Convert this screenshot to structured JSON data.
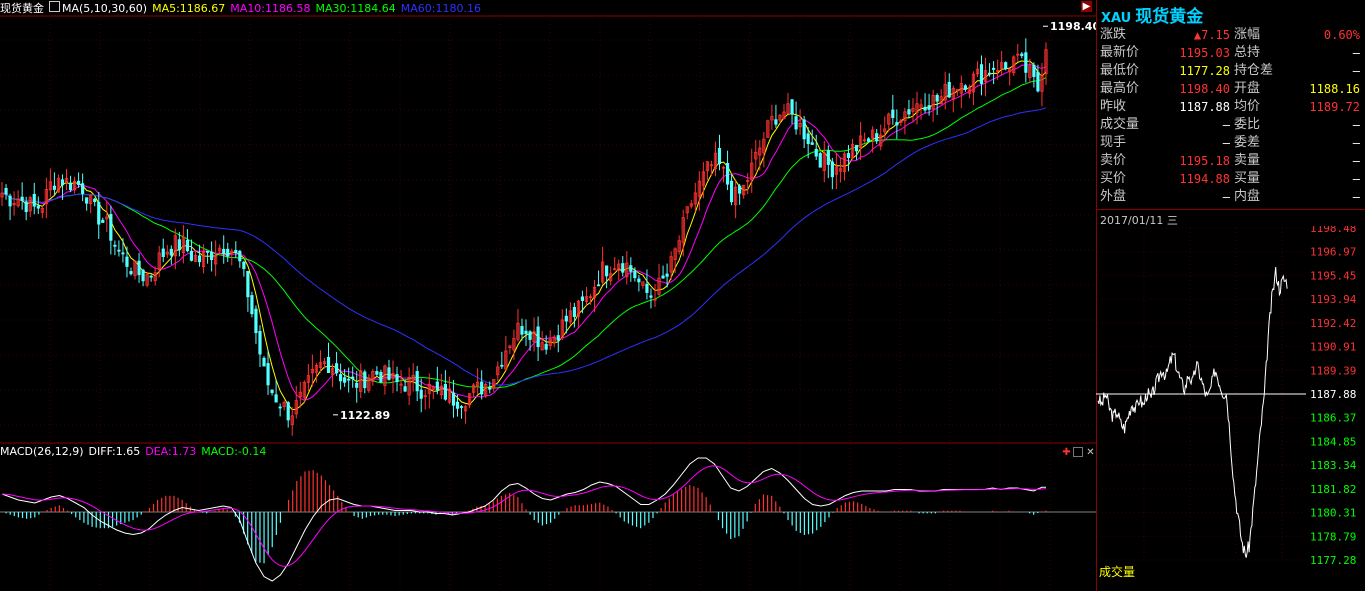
{
  "window": {
    "symbol_name": "现货黄金",
    "ma_indicator": "MA(5,10,30,60)",
    "ma5": "MA5:1186.67",
    "ma10": "MA10:1186.58",
    "ma30": "MA30:1184.64",
    "ma60": "MA60:1180.16",
    "macd_indicator": "MACD(26,12,9)",
    "diff": "DIFF:1.65",
    "dea": "DEA:1.73",
    "macd": "MACD:-0.14",
    "colors": {
      "ma5": "#ffff00",
      "ma10": "#ff00ff",
      "ma30": "#00ff00",
      "ma60": "#3030ff",
      "up": "#ff3232",
      "down": "#54ffff",
      "accent": "#00d2ff"
    }
  },
  "quote_panel": {
    "code": "XAU",
    "name": "现货黄金",
    "rows": [
      {
        "l1": "涨跌",
        "v1": "▲7.15",
        "c1": "red",
        "l2": "涨幅",
        "v2": "0.60%",
        "c2": "red"
      },
      {
        "l1": "最新价",
        "v1": "1195.03",
        "c1": "red",
        "l2": "总持",
        "v2": "—",
        "c2": "wht"
      },
      {
        "l1": "最低价",
        "v1": "1177.28",
        "c1": "yel",
        "l2": "持仓差",
        "v2": "—",
        "c2": "wht"
      },
      {
        "l1": "最高价",
        "v1": "1198.40",
        "c1": "red",
        "l2": "开盘",
        "v2": "1188.16",
        "c2": "yel"
      },
      {
        "l1": "昨收",
        "v1": "1187.88",
        "c1": "wht",
        "l2": "均价",
        "v2": "1189.72",
        "c2": "red"
      },
      {
        "l1": "成交量",
        "v1": "—",
        "c1": "wht",
        "l2": "委比",
        "v2": "—",
        "c2": "wht"
      },
      {
        "l1": "现手",
        "v1": "—",
        "c1": "wht",
        "l2": "委差",
        "v2": "—",
        "c2": "wht"
      },
      {
        "l1": "卖价",
        "v1": "1195.18",
        "c1": "red",
        "l2": "卖量",
        "v2": "—",
        "c2": "wht"
      },
      {
        "l1": "买价",
        "v1": "1194.88",
        "c1": "red",
        "l2": "买量",
        "v2": "—",
        "c2": "wht"
      },
      {
        "l1": "外盘",
        "v1": "—",
        "c1": "wht",
        "l2": "内盘",
        "v2": "—",
        "c2": "wht"
      }
    ],
    "date": "2017/01/11 三",
    "volume_label": "成交量"
  },
  "chart_data": [
    {
      "type": "line",
      "subtype": "candlestick",
      "title": "现货黄金",
      "xlabel": "",
      "ylabel": "",
      "ylim": [
        1118,
        1200
      ],
      "grid": true,
      "annotations": [
        "1198.40",
        "1122.89"
      ],
      "series": [
        {
          "name": "MA5",
          "color": "#ffff00"
        },
        {
          "name": "MA10",
          "color": "#ff00ff"
        },
        {
          "name": "MA30",
          "color": "#00ff00"
        },
        {
          "name": "MA60",
          "color": "#3030ff"
        }
      ],
      "close_path": [
        1166,
        1165,
        1165,
        1164,
        1163,
        1164,
        1168,
        1169,
        1168,
        1168,
        1167,
        1163,
        1161,
        1159,
        1155,
        1153,
        1151,
        1150,
        1150,
        1153,
        1155,
        1156,
        1156,
        1154,
        1153,
        1154,
        1155,
        1156,
        1155,
        1152,
        1146,
        1138,
        1130,
        1127,
        1125,
        1123,
        1125,
        1128,
        1131,
        1133,
        1133,
        1131,
        1129,
        1129,
        1130,
        1131,
        1131,
        1130,
        1129,
        1129,
        1129,
        1128,
        1128,
        1127,
        1127,
        1126,
        1126,
        1127,
        1128,
        1129,
        1131,
        1135,
        1138,
        1140,
        1140,
        1138,
        1137,
        1138,
        1140,
        1142,
        1143,
        1145,
        1148,
        1151,
        1152,
        1153,
        1152,
        1150,
        1147,
        1146,
        1148,
        1150,
        1155,
        1160,
        1165,
        1168,
        1171,
        1172,
        1169,
        1165,
        1166,
        1170,
        1174,
        1178,
        1181,
        1182,
        1181,
        1179,
        1177,
        1174,
        1172,
        1171,
        1172,
        1174,
        1175,
        1176,
        1177,
        1178,
        1180,
        1181,
        1182,
        1183,
        1184,
        1184,
        1184,
        1186,
        1187,
        1188,
        1188,
        1189,
        1190,
        1191,
        1190,
        1192,
        1191,
        1189,
        1186,
        1195
      ],
      "macd_values": [
        1.2,
        1.0,
        0.8,
        0.7,
        0.6,
        0.8,
        1.0,
        1.1,
        0.9,
        0.6,
        0.3,
        -0.2,
        -0.6,
        -0.9,
        -1.2,
        -1.4,
        -1.5,
        -1.4,
        -1.1,
        -0.6,
        -0.2,
        0.1,
        0.3,
        0.2,
        0.1,
        0.2,
        0.3,
        0.4,
        0.3,
        -0.5,
        -2.0,
        -3.4,
        -4.3,
        -4.6,
        -4.2,
        -3.4,
        -2.3,
        -1.2,
        -0.3,
        0.4,
        0.8,
        0.9,
        0.7,
        0.5,
        0.4,
        0.4,
        0.3,
        0.2,
        0.1,
        0.1,
        0.1,
        0.0,
        0.0,
        -0.1,
        -0.1,
        -0.2,
        -0.1,
        0.0,
        0.2,
        0.4,
        0.8,
        1.4,
        1.8,
        1.9,
        1.6,
        1.2,
        0.9,
        0.8,
        1.0,
        1.2,
        1.3,
        1.5,
        1.8,
        2.0,
        1.9,
        1.7,
        1.3,
        0.9,
        0.5,
        0.5,
        0.8,
        1.2,
        1.8,
        2.5,
        3.2,
        3.6,
        3.6,
        3.2,
        2.4,
        1.6,
        1.4,
        1.7,
        2.2,
        2.7,
        2.9,
        2.6,
        2.1,
        1.5,
        0.9,
        0.5,
        0.4,
        0.5,
        0.8,
        1.1,
        1.3,
        1.4,
        1.4,
        1.4,
        1.4,
        1.5,
        1.5,
        1.5,
        1.4,
        1.4,
        1.4,
        1.5,
        1.5,
        1.5,
        1.5,
        1.5,
        1.5,
        1.6,
        1.5,
        1.6,
        1.6,
        1.5,
        1.4,
        1.65
      ]
    },
    {
      "type": "line",
      "subtype": "intraday",
      "date": "2017/01/11 三",
      "ylim": [
        1177.28,
        1198.48
      ],
      "y_tick_labels": [
        "1198.48",
        "1196.97",
        "1195.45",
        "1193.94",
        "1192.42",
        "1190.91",
        "1189.39",
        "1187.88",
        "1186.37",
        "1184.85",
        "1183.34",
        "1181.82",
        "1180.31",
        "1178.79",
        "1177.28"
      ],
      "reference": 1187.88,
      "prices": [
        1187.6,
        1187.2,
        1187.9,
        1187.0,
        1186.4,
        1186.8,
        1186.0,
        1185.7,
        1186.5,
        1187.3,
        1186.9,
        1187.6,
        1187.1,
        1188.0,
        1187.5,
        1188.3,
        1188.9,
        1189.5,
        1189.0,
        1189.9,
        1190.4,
        1189.4,
        1188.6,
        1188.2,
        1189.2,
        1188.5,
        1189.8,
        1189.1,
        1188.2,
        1187.6,
        1188.4,
        1189.5,
        1188.7,
        1188.0,
        1187.9,
        1185.0,
        1182.0,
        1180.1,
        1178.5,
        1177.6,
        1178.2,
        1180.5,
        1183.0,
        1185.6,
        1187.8,
        1191.5,
        1194.0,
        1195.7,
        1194.6,
        1195.2,
        1195.03
      ]
    }
  ]
}
